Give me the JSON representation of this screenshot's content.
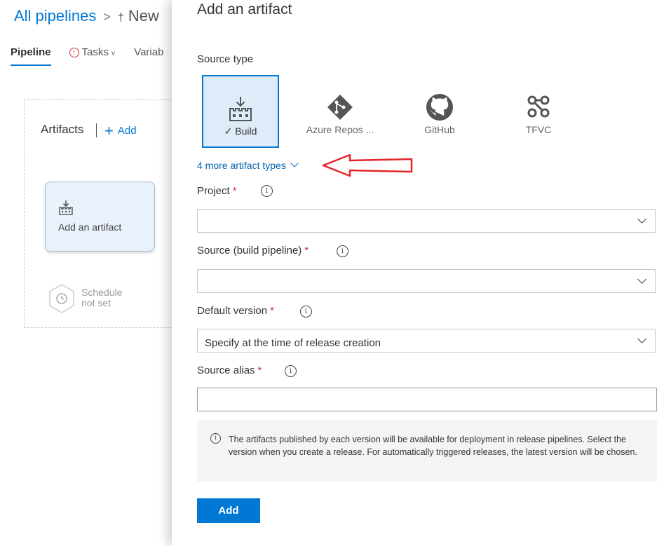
{
  "background": {
    "breadcrumb": {
      "root": "All pipelines",
      "separator": ">",
      "pipeline_icon": "†",
      "current": "New"
    },
    "tabs": [
      {
        "label": "Pipeline"
      },
      {
        "label": "Tasks"
      },
      {
        "label": "Variab"
      }
    ],
    "artifacts_heading": "Artifacts",
    "add_label": "Add",
    "artifact_card_label": "Add an artifact",
    "schedule_line1": "Schedule",
    "schedule_line2": "not set"
  },
  "panel": {
    "title": "Add an artifact",
    "source_type_label": "Source type",
    "source_types": [
      {
        "label": "Build",
        "icon": "build-icon",
        "selected": true
      },
      {
        "label": "Azure Repos ...",
        "icon": "git-icon",
        "selected": false
      },
      {
        "label": "GitHub",
        "icon": "github-icon",
        "selected": false
      },
      {
        "label": "TFVC",
        "icon": "tfvc-icon",
        "selected": false
      }
    ],
    "more_types_label": "4 more artifact types",
    "fields": {
      "project": {
        "label": "Project",
        "value": ""
      },
      "source": {
        "label": "Source (build pipeline)",
        "value": ""
      },
      "default_version": {
        "label": "Default version",
        "value": "Specify at the time of release creation"
      },
      "source_alias": {
        "label": "Source alias",
        "value": ""
      }
    },
    "required_marker": "*",
    "info_message": "The artifacts published by each version will be available for deployment in release pipelines. Select the version when you create a release. For automatically triggered releases, the latest version will be chosen.",
    "add_button_label": "Add"
  },
  "colors": {
    "accent": "#0078d4",
    "required": "#d13438",
    "annotation_arrow": "#e3262b"
  }
}
